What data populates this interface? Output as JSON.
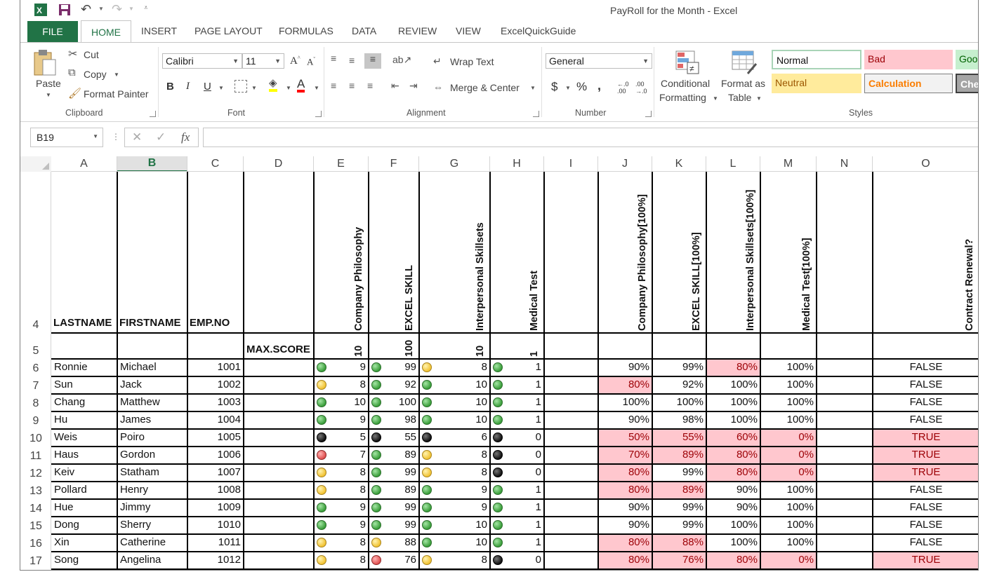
{
  "window": {
    "title": "PayRoll for the Month - Excel"
  },
  "tabs": {
    "file": "FILE",
    "home": "HOME",
    "insert": "INSERT",
    "page_layout": "PAGE LAYOUT",
    "formulas": "FORMULAS",
    "data": "DATA",
    "review": "REVIEW",
    "view": "VIEW",
    "addin": "ExcelQuickGuide"
  },
  "clipboard": {
    "paste": "Paste",
    "cut": "Cut",
    "copy": "Copy",
    "format_painter": "Format Painter",
    "group": "Clipboard"
  },
  "font": {
    "name": "Calibri",
    "size": "11",
    "bold": "B",
    "italic": "I",
    "underline": "U",
    "group": "Font"
  },
  "alignment": {
    "wrap_text": "Wrap Text",
    "merge_center": "Merge & Center",
    "group": "Alignment"
  },
  "number": {
    "format": "General",
    "currency": "$",
    "percent": "%",
    "comma": ",",
    "group": "Number"
  },
  "styles": {
    "conditional_1": "Conditional",
    "conditional_2": "Formatting",
    "format_as_1": "Format as",
    "format_as_2": "Table",
    "normal": "Normal",
    "bad": "Bad",
    "good": "Goo",
    "neutral": "Neutral",
    "calculation": "Calculation",
    "check": "Che",
    "group": "Styles"
  },
  "formula_bar": {
    "name_box": "B19",
    "fx": "fx",
    "content": ""
  },
  "columns": [
    "A",
    "B",
    "C",
    "D",
    "E",
    "F",
    "G",
    "H",
    "I",
    "J",
    "K",
    "L",
    "M",
    "N",
    "O"
  ],
  "selected_column": "B",
  "headers": {
    "row_label": "4",
    "lastname": "LASTNAME",
    "firstname": "FIRSTNAME",
    "empno": "EMP.NO",
    "e": "Company Philosophy",
    "f": "EXCEL SKILL",
    "g": "Interpersonal Skillsets",
    "h": "Medical Test",
    "j": "Company Philosophy[100%]",
    "k": "EXCEL SKILL[100%]",
    "l": "Interpersonal Skillsets[100%]",
    "m": "Medical Test[100%]",
    "o": "Contract Renewal?"
  },
  "max_row": {
    "row_label": "5",
    "label": "MAX.SCORE",
    "e": "10",
    "f": "100",
    "g": "10",
    "h": "1"
  },
  "rows": [
    {
      "n": "6",
      "last": "Ronnie",
      "first": "Michael",
      "emp": "1001",
      "e": "9",
      "ei": "g",
      "f": "99",
      "fi": "g",
      "g": "8",
      "gi": "y",
      "h": "1",
      "hi": "g",
      "j": "90%",
      "jp": false,
      "k": "99%",
      "kp": false,
      "l": "80%",
      "lp": true,
      "m": "100%",
      "mp": false,
      "o": "FALSE",
      "op": false
    },
    {
      "n": "7",
      "last": "Sun",
      "first": "Jack",
      "emp": "1002",
      "e": "8",
      "ei": "y",
      "f": "92",
      "fi": "g",
      "g": "10",
      "gi": "g",
      "h": "1",
      "hi": "g",
      "j": "80%",
      "jp": true,
      "k": "92%",
      "kp": false,
      "l": "100%",
      "lp": false,
      "m": "100%",
      "mp": false,
      "o": "FALSE",
      "op": false
    },
    {
      "n": "8",
      "last": "Chang",
      "first": "Matthew",
      "emp": "1003",
      "e": "10",
      "ei": "g",
      "f": "100",
      "fi": "g",
      "g": "10",
      "gi": "g",
      "h": "1",
      "hi": "g",
      "j": "100%",
      "jp": false,
      "k": "100%",
      "kp": false,
      "l": "100%",
      "lp": false,
      "m": "100%",
      "mp": false,
      "o": "FALSE",
      "op": false
    },
    {
      "n": "9",
      "last": "Hu",
      "first": "James",
      "emp": "1004",
      "e": "9",
      "ei": "g",
      "f": "98",
      "fi": "g",
      "g": "10",
      "gi": "g",
      "h": "1",
      "hi": "g",
      "j": "90%",
      "jp": false,
      "k": "98%",
      "kp": false,
      "l": "100%",
      "lp": false,
      "m": "100%",
      "mp": false,
      "o": "FALSE",
      "op": false
    },
    {
      "n": "10",
      "last": "Weis",
      "first": "Poiro",
      "emp": "1005",
      "e": "5",
      "ei": "k",
      "f": "55",
      "fi": "k",
      "g": "6",
      "gi": "k",
      "h": "0",
      "hi": "k",
      "j": "50%",
      "jp": true,
      "k": "55%",
      "kp": true,
      "l": "60%",
      "lp": true,
      "m": "0%",
      "mp": true,
      "o": "TRUE",
      "op": true
    },
    {
      "n": "11",
      "last": "Haus",
      "first": "Gordon",
      "emp": "1006",
      "e": "7",
      "ei": "r",
      "f": "89",
      "fi": "g",
      "g": "8",
      "gi": "y",
      "h": "0",
      "hi": "k",
      "j": "70%",
      "jp": true,
      "k": "89%",
      "kp": true,
      "l": "80%",
      "lp": true,
      "m": "0%",
      "mp": true,
      "o": "TRUE",
      "op": true
    },
    {
      "n": "12",
      "last": "Keiv",
      "first": "Statham",
      "emp": "1007",
      "e": "8",
      "ei": "y",
      "f": "99",
      "fi": "g",
      "g": "8",
      "gi": "y",
      "h": "0",
      "hi": "k",
      "j": "80%",
      "jp": true,
      "k": "99%",
      "kp": false,
      "l": "80%",
      "lp": true,
      "m": "0%",
      "mp": true,
      "o": "TRUE",
      "op": true
    },
    {
      "n": "13",
      "last": "Pollard",
      "first": "Henry",
      "emp": "1008",
      "e": "8",
      "ei": "y",
      "f": "89",
      "fi": "g",
      "g": "9",
      "gi": "g",
      "h": "1",
      "hi": "g",
      "j": "80%",
      "jp": true,
      "k": "89%",
      "kp": true,
      "l": "90%",
      "lp": false,
      "m": "100%",
      "mp": false,
      "o": "FALSE",
      "op": false
    },
    {
      "n": "14",
      "last": "Hue",
      "first": "Jimmy",
      "emp": "1009",
      "e": "9",
      "ei": "g",
      "f": "99",
      "fi": "g",
      "g": "9",
      "gi": "g",
      "h": "1",
      "hi": "g",
      "j": "90%",
      "jp": false,
      "k": "99%",
      "kp": false,
      "l": "90%",
      "lp": false,
      "m": "100%",
      "mp": false,
      "o": "FALSE",
      "op": false
    },
    {
      "n": "15",
      "last": "Dong",
      "first": "Sherry",
      "emp": "1010",
      "e": "9",
      "ei": "g",
      "f": "99",
      "fi": "g",
      "g": "10",
      "gi": "g",
      "h": "1",
      "hi": "g",
      "j": "90%",
      "jp": false,
      "k": "99%",
      "kp": false,
      "l": "100%",
      "lp": false,
      "m": "100%",
      "mp": false,
      "o": "FALSE",
      "op": false
    },
    {
      "n": "16",
      "last": "Xin",
      "first": "Catherine",
      "emp": "1011",
      "e": "8",
      "ei": "y",
      "f": "88",
      "fi": "y",
      "g": "10",
      "gi": "g",
      "h": "1",
      "hi": "g",
      "j": "80%",
      "jp": true,
      "k": "88%",
      "kp": true,
      "l": "100%",
      "lp": false,
      "m": "100%",
      "mp": false,
      "o": "FALSE",
      "op": false
    },
    {
      "n": "17",
      "last": "Song",
      "first": "Angelina",
      "emp": "1012",
      "e": "8",
      "ei": "y",
      "f": "76",
      "fi": "r",
      "g": "8",
      "gi": "y",
      "h": "0",
      "hi": "k",
      "j": "80%",
      "jp": true,
      "k": "76%",
      "kp": true,
      "l": "80%",
      "lp": true,
      "m": "0%",
      "mp": true,
      "o": "TRUE",
      "op": true
    }
  ],
  "colors": {
    "excel_green": "#217346",
    "bad_fill": "#ffc7ce",
    "bad_text": "#9c0006"
  }
}
